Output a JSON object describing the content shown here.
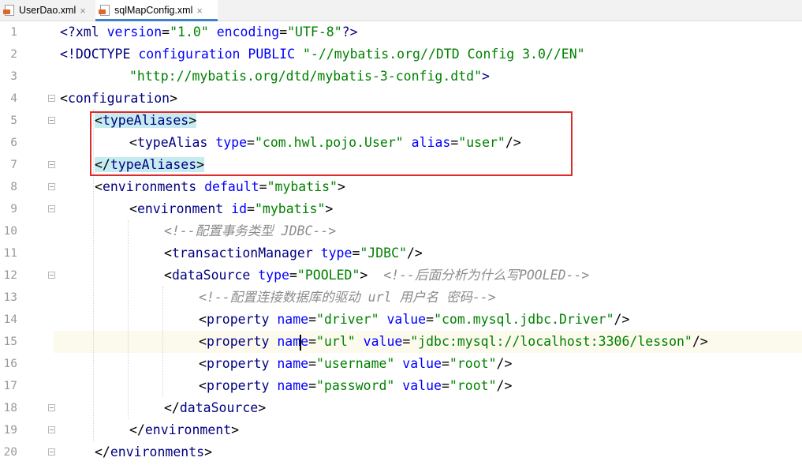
{
  "tabs": [
    {
      "label": "UserDao.xml",
      "active": false
    },
    {
      "label": "sqlMapConfig.xml",
      "active": true
    }
  ],
  "close_glyph": "×",
  "line_numbers": [
    "1",
    "2",
    "3",
    "4",
    "5",
    "6",
    "7",
    "8",
    "9",
    "10",
    "11",
    "12",
    "13",
    "14",
    "15",
    "16",
    "17",
    "18",
    "19",
    "20"
  ],
  "current_line": 15,
  "colors": {
    "tag": "#000080",
    "attr": "#0000ff",
    "value": "#008000",
    "comment": "#8c8c8c",
    "highlight": "#c6ebf0",
    "box": "#dd2a2a"
  },
  "code": {
    "l1": {
      "open": "<?xml ",
      "a1": "version",
      "eq1": "=",
      "v1": "\"1.0\"",
      "sp": " ",
      "a2": "encoding",
      "eq2": "=",
      "v2": "\"UTF-8\"",
      "close": "?>"
    },
    "l2": {
      "t": "<!DOCTYPE ",
      "a": "configuration PUBLIC ",
      "v": "\"-//mybatis.org//DTD Config 3.0//EN\""
    },
    "l3": {
      "v": "\"http://mybatis.org/dtd/mybatis-3-config.dtd\"",
      "close": ">"
    },
    "l4": {
      "lt": "<",
      "t": "configuration",
      "gt": ">"
    },
    "l5": {
      "lt": "<",
      "t": "typeAliases",
      "gt": ">"
    },
    "l6": {
      "lt": "<",
      "t": "typeAlias ",
      "a1": "type",
      "eq1": "=",
      "v1": "\"com.hwl.pojo.User\"",
      "a2": " alias",
      "eq2": "=",
      "v2": "\"user\"",
      "close": "/>"
    },
    "l7": {
      "lt": "</",
      "t": "typeAliases",
      "gt": ">"
    },
    "l8": {
      "lt": "<",
      "t": "environments ",
      "a": "default",
      "eq": "=",
      "v": "\"mybatis\"",
      "gt": ">"
    },
    "l9": {
      "lt": "<",
      "t": "environment ",
      "a": "id",
      "eq": "=",
      "v": "\"mybatis\"",
      "gt": ">"
    },
    "l10": {
      "c": "<!--配置事务类型 JDBC-->"
    },
    "l11": {
      "lt": "<",
      "t": "transactionManager ",
      "a": "type",
      "eq": "=",
      "v": "\"JDBC\"",
      "close": "/>"
    },
    "l12": {
      "lt": "<",
      "t": "dataSource ",
      "a": "type",
      "eq": "=",
      "v": "\"POOLED\"",
      "gt": ">",
      "sp": "  ",
      "c": "<!--后面分析为什么写POOLED-->"
    },
    "l13": {
      "c": "<!--配置连接数据库的驱动 url 用户名 密码-->"
    },
    "l14": {
      "lt": "<",
      "t": "property ",
      "a1": "name",
      "eq1": "=",
      "v1": "\"driver\"",
      "a2": " value",
      "eq2": "=",
      "v2": "\"com.mysql.jdbc.Driver\"",
      "close": "/>"
    },
    "l15": {
      "lt": "<",
      "t": "property ",
      "a1a": "nam",
      "a1b": "e",
      "eq1": "=",
      "v1": "\"url\"",
      "a2": " value",
      "eq2": "=",
      "v2": "\"jdbc:mysql://localhost:3306/lesson\"",
      "close": "/>"
    },
    "l16": {
      "lt": "<",
      "t": "property ",
      "a1": "name",
      "eq1": "=",
      "v1": "\"username\"",
      "a2": " value",
      "eq2": "=",
      "v2": "\"root\"",
      "close": "/>"
    },
    "l17": {
      "lt": "<",
      "t": "property ",
      "a1": "name",
      "eq1": "=",
      "v1": "\"password\"",
      "a2": " value",
      "eq2": "=",
      "v2": "\"root\"",
      "close": "/>"
    },
    "l18": {
      "lt": "</",
      "t": "dataSource",
      "gt": ">"
    },
    "l19": {
      "lt": "</",
      "t": "environment",
      "gt": ">"
    },
    "l20": {
      "lt": "</",
      "t": "environments",
      "gt": ">"
    }
  }
}
